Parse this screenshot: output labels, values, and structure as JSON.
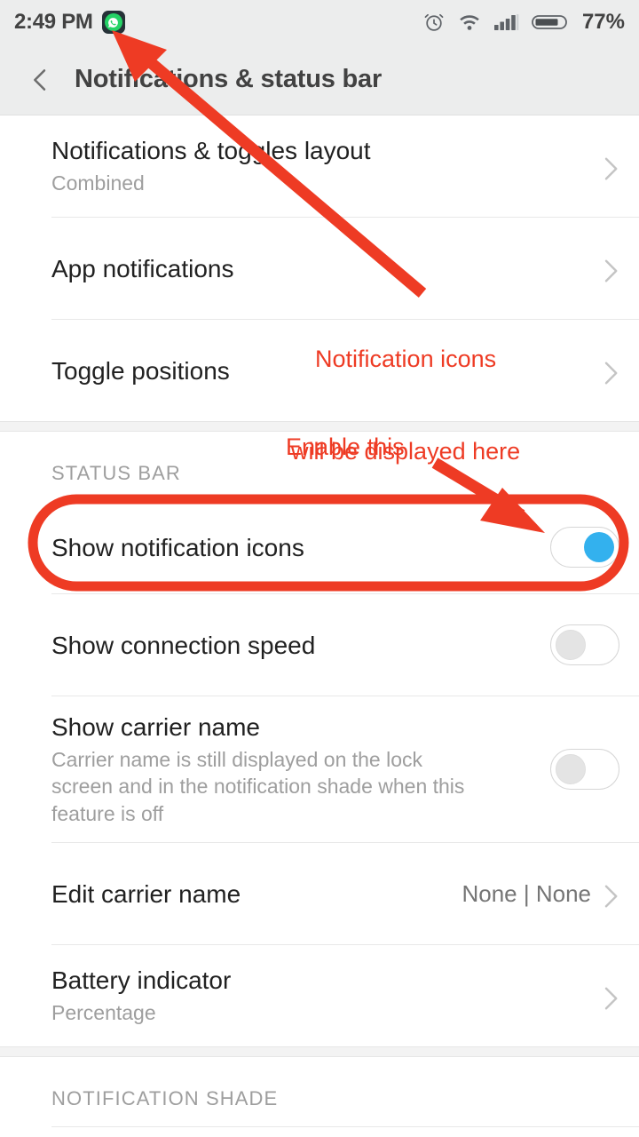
{
  "status_bar": {
    "time": "2:49 PM",
    "app_icon": "whatsapp-icon",
    "icons": [
      "alarm-icon",
      "wifi-icon",
      "signal-icon",
      "battery-icon"
    ],
    "battery_percent": "77%"
  },
  "appbar": {
    "back_icon": "back-chevron-icon",
    "title": "Notifications & status bar"
  },
  "sections": [
    {
      "header": "",
      "rows": [
        {
          "title": "Notifications & toggles layout",
          "subtitle": "Combined",
          "control": "chevron"
        },
        {
          "title": "App notifications",
          "subtitle": "",
          "control": "chevron"
        },
        {
          "title": "Toggle positions",
          "subtitle": "",
          "control": "chevron"
        }
      ]
    },
    {
      "header": "STATUS BAR",
      "rows": [
        {
          "title": "Show notification icons",
          "subtitle": "",
          "control": "toggle",
          "toggle_state": "on"
        },
        {
          "title": "Show connection speed",
          "subtitle": "",
          "control": "toggle",
          "toggle_state": "off"
        },
        {
          "title": "Show carrier name",
          "subtitle": "Carrier name is still displayed on the lock screen and in the notification shade when this feature is off",
          "control": "toggle",
          "toggle_state": "off"
        },
        {
          "title": "Edit carrier name",
          "subtitle": "",
          "value": "None | None",
          "control": "chevron"
        },
        {
          "title": "Battery indicator",
          "subtitle": "Percentage",
          "control": "chevron"
        }
      ]
    },
    {
      "header": "NOTIFICATION SHADE",
      "rows": []
    }
  ],
  "annotations": {
    "color": "#ee3b24",
    "notification_icons_note_line1": "Notification icons",
    "notification_icons_note_line2": "will be displayed here",
    "enable_note": "Enable this",
    "highlight_target": "Show notification icons"
  }
}
